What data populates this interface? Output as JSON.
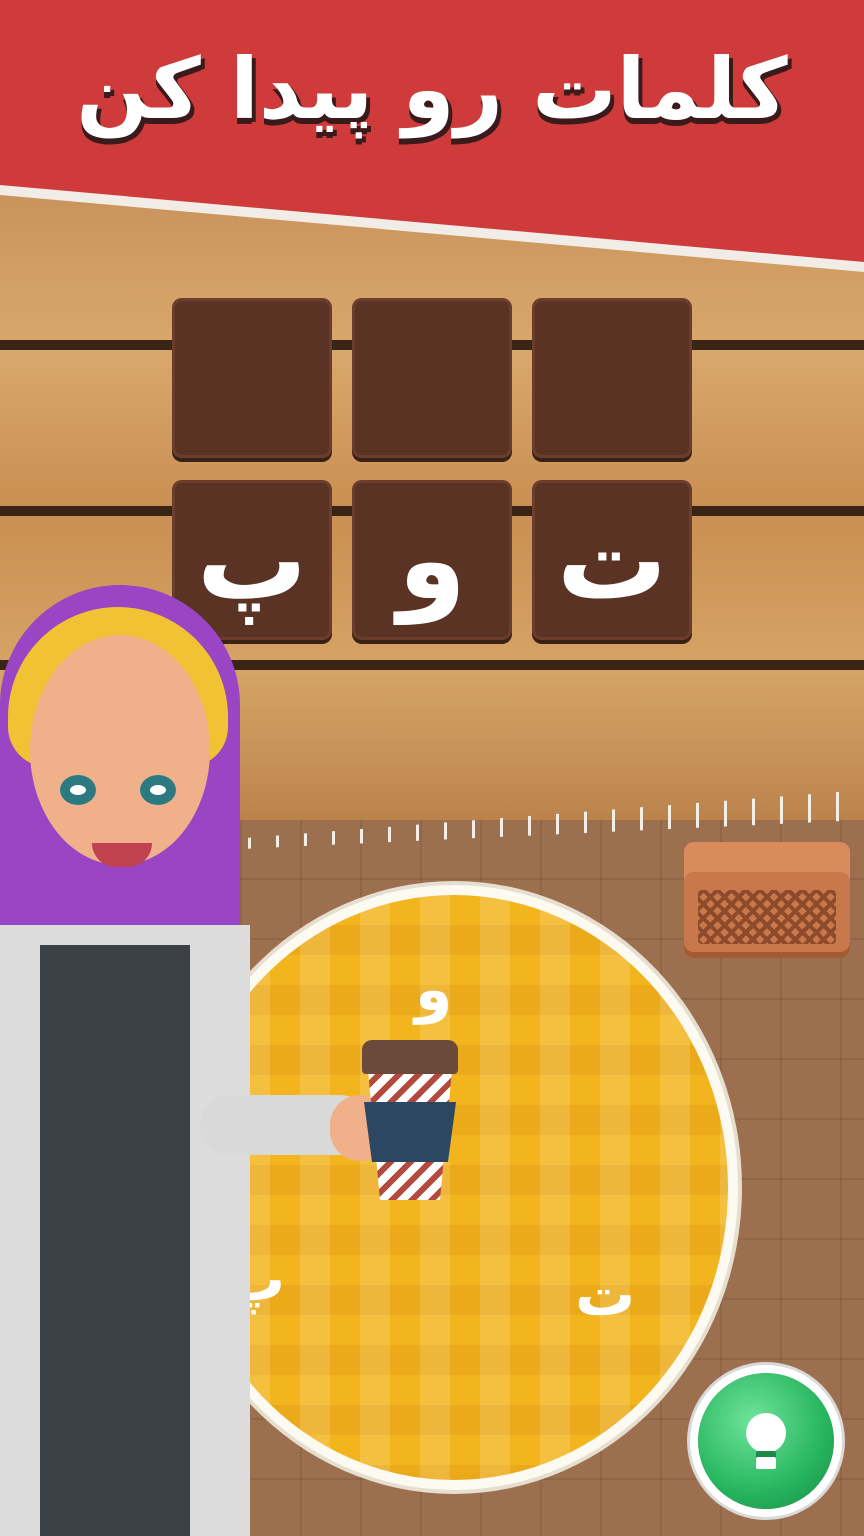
{
  "header": {
    "title": "کلمات رو پیدا کن"
  },
  "board": {
    "row1": [
      "",
      "",
      ""
    ],
    "row2": [
      "پ",
      "و",
      "ت"
    ]
  },
  "wheel": {
    "letters": {
      "top": "و",
      "left": "پ",
      "right": "ت"
    }
  },
  "controls": {
    "hint_icon": "lightbulb-icon"
  },
  "colors": {
    "banner": "#cf3a3a",
    "tile": "#5a3325",
    "wheel": "#f3b51e",
    "hint": "#26b55e"
  }
}
